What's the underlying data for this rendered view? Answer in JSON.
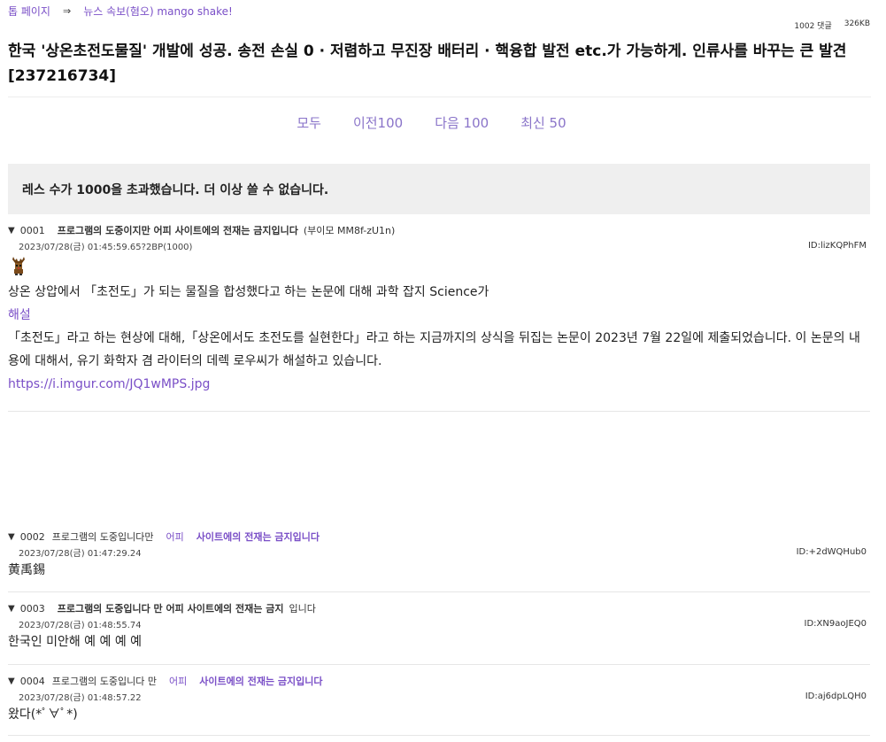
{
  "nav": {
    "top_page": "톱 페이지",
    "sep": "⇒",
    "board": "뉴스 속보(혐오) mango shake!"
  },
  "meta": {
    "comments": "1002 댓글",
    "size": "326KB"
  },
  "thread": {
    "title": "한국 '상온초전도물질' 개발에 성공. 송전 손실 0 · 저렴하고 무진장 배터리 · 핵융합 발전 etc.가 가능하게. 인류사를 바꾸는 큰 발견 [237216734]"
  },
  "pager": {
    "all": "모두",
    "prev": "이전100",
    "next": "다음 100",
    "latest": "최신 50"
  },
  "notice": "레스 수가 1000을 초과했습니다. 더 이상 쓸 수 없습니다.",
  "posts": [
    {
      "num": "0001",
      "name": "프로그램의 도중이지만 어피 사이트에의 전재는 금지입니다",
      "trip": "(부이모 MM8f-zU1n)",
      "date": "2023/07/28(금) 01:45:59.65?2BP(1000)",
      "id": "ID:lizKQPhFM",
      "line1": "상온 상압에서 「초전도」가 되는 물질을 합성했다고 하는 논문에 대해 과학 잡지 Science가",
      "link1": "해설",
      "line2": "「초전도」라고 하는 현상에 대해,「상온에서도 초전도를 실현한다」라고 하는 지금까지의 상식을 뒤집는 논문이 2023년 7월 22일에 제출되었습니다. 이 논문의 내용에 대해서, 유기 화학자 겸 라이터의 데렉 로우씨가 해설하고 있습니다.",
      "link2": "https://i.imgur.com/JQ1wMPS.jpg"
    },
    {
      "num": "0002",
      "name_a": "프로그램의 도중입니다만",
      "name_b": "어피",
      "name_c": "사이트에의 전재는 금지입니다",
      "date": "2023/07/28(금) 01:47:29.24",
      "id": "ID:+2dWQHub0",
      "body": "黄禹錫"
    },
    {
      "num": "0003",
      "name": "프로그램의 도중입니다 만 어피 사이트에의 전재는 금지",
      "name_tail": "입니다",
      "date": "2023/07/28(금) 01:48:55.74",
      "id": "ID:XN9aoJEQ0",
      "body": "한국인 미안해 예 예 예 예"
    },
    {
      "num": "0004",
      "name_a": "프로그램의 도중입니다 만",
      "name_b": "어피",
      "name_c": "사이트에의 전재는 금지입니다",
      "date": "2023/07/28(금) 01:48:57.22",
      "id": "ID:aj6dpLQH0",
      "body": "왔다(*ﾟ∀ﾟ*)"
    }
  ]
}
